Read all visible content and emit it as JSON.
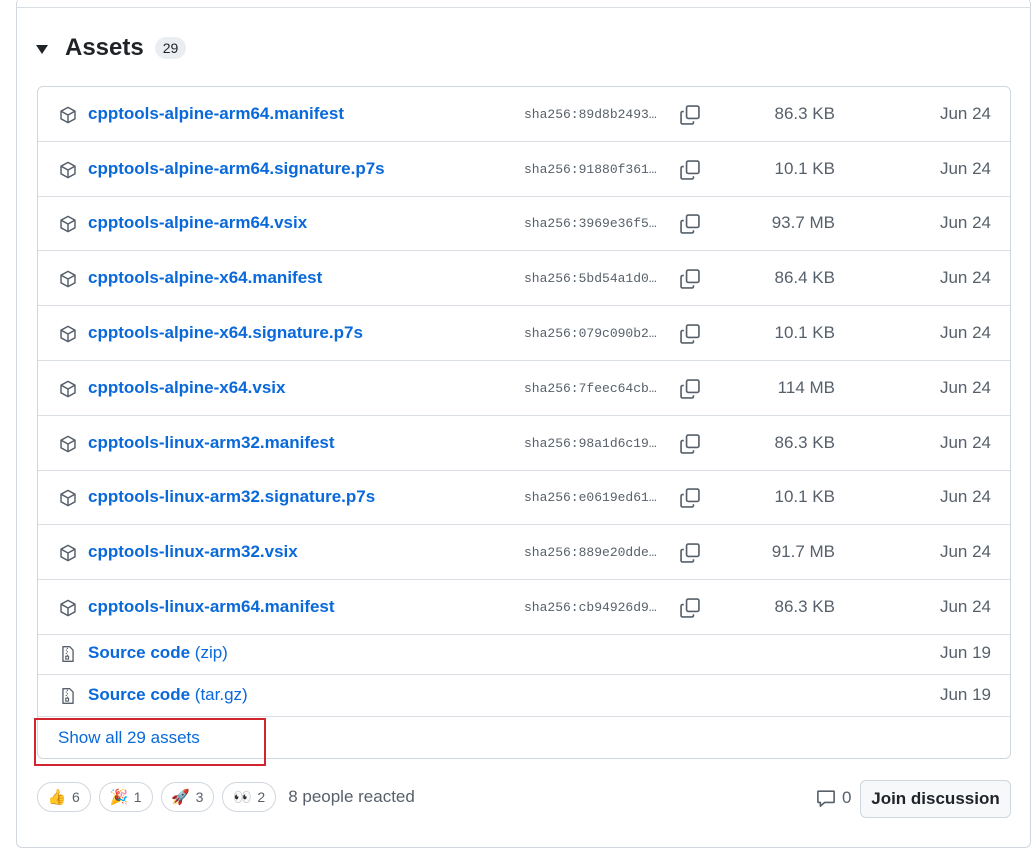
{
  "assets": {
    "title": "Assets",
    "count": "29",
    "files": [
      {
        "name": "cpptools-alpine-arm64.manifest",
        "sha": "sha256:89d8b2493…",
        "size": "86.3 KB",
        "date": "Jun 24"
      },
      {
        "name": "cpptools-alpine-arm64.signature.p7s",
        "sha": "sha256:91880f361…",
        "size": "10.1 KB",
        "date": "Jun 24"
      },
      {
        "name": "cpptools-alpine-arm64.vsix",
        "sha": "sha256:3969e36f5…",
        "size": "93.7 MB",
        "date": "Jun 24"
      },
      {
        "name": "cpptools-alpine-x64.manifest",
        "sha": "sha256:5bd54a1d0…",
        "size": "86.4 KB",
        "date": "Jun 24"
      },
      {
        "name": "cpptools-alpine-x64.signature.p7s",
        "sha": "sha256:079c090b2…",
        "size": "10.1 KB",
        "date": "Jun 24"
      },
      {
        "name": "cpptools-alpine-x64.vsix",
        "sha": "sha256:7feec64cb…",
        "size": "114 MB",
        "date": "Jun 24"
      },
      {
        "name": "cpptools-linux-arm32.manifest",
        "sha": "sha256:98a1d6c19…",
        "size": "86.3 KB",
        "date": "Jun 24"
      },
      {
        "name": "cpptools-linux-arm32.signature.p7s",
        "sha": "sha256:e0619ed61…",
        "size": "10.1 KB",
        "date": "Jun 24"
      },
      {
        "name": "cpptools-linux-arm32.vsix",
        "sha": "sha256:889e20dde…",
        "size": "91.7 MB",
        "date": "Jun 24"
      },
      {
        "name": "cpptools-linux-arm64.manifest",
        "sha": "sha256:cb94926d9…",
        "size": "86.3 KB",
        "date": "Jun 24"
      }
    ],
    "sources": [
      {
        "name": "Source code",
        "suffix": "(zip)",
        "date": "Jun 19"
      },
      {
        "name": "Source code",
        "suffix": "(tar.gz)",
        "date": "Jun 19"
      }
    ],
    "show_all": "Show all 29 assets"
  },
  "reactions": {
    "items": [
      {
        "emoji": "👍",
        "icon": "thumbs-up-icon",
        "count": "6"
      },
      {
        "emoji": "🎉",
        "icon": "party-popper-icon",
        "count": "1"
      },
      {
        "emoji": "🚀",
        "icon": "rocket-icon",
        "count": "3"
      },
      {
        "emoji": "👀",
        "icon": "eyes-icon",
        "count": "2"
      }
    ],
    "summary": "8 people reacted"
  },
  "discussion": {
    "comment_count": "0",
    "join_label": "Join discussion"
  },
  "colors": {
    "link": "#0969da",
    "muted": "#57606a",
    "border": "#d0d7de",
    "highlight": "#d1242f"
  }
}
